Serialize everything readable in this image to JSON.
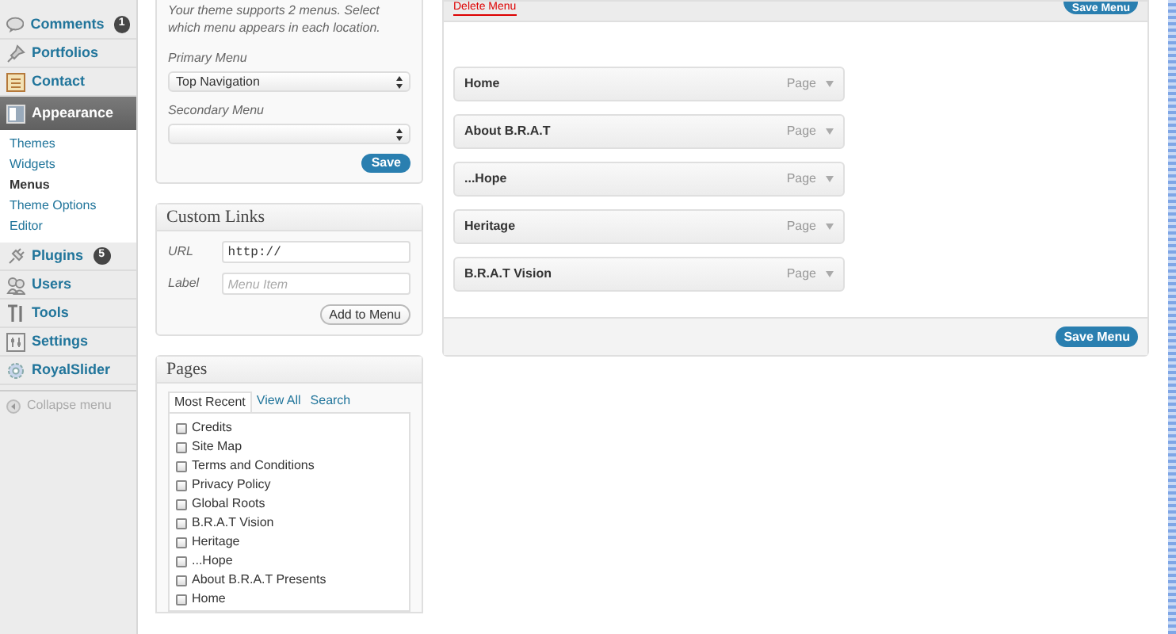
{
  "sidebar": {
    "items": [
      {
        "label": "Comments",
        "badge": "1",
        "selected": false
      },
      {
        "label": "Portfolios",
        "selected": false
      },
      {
        "label": "Contact",
        "selected": false
      },
      {
        "label": "Appearance",
        "selected": true,
        "children": [
          {
            "label": "Themes",
            "selected": false
          },
          {
            "label": "Widgets",
            "selected": false
          },
          {
            "label": "Menus",
            "selected": true
          },
          {
            "label": "Theme Options",
            "selected": false
          },
          {
            "label": "Editor",
            "selected": false
          }
        ]
      },
      {
        "label": "Plugins",
        "badge": "5",
        "selected": false
      },
      {
        "label": "Users",
        "selected": false
      },
      {
        "label": "Tools",
        "selected": false
      },
      {
        "label": "Settings",
        "selected": false
      },
      {
        "label": "RoyalSlider",
        "selected": false
      }
    ],
    "collapse": "Collapse menu"
  },
  "locations": {
    "note": "Your theme supports 2 menus. Select which menu appears in each location.",
    "fields": [
      {
        "label": "Primary Menu",
        "value": "Top Navigation"
      },
      {
        "label": "Secondary Menu"
      }
    ],
    "button": "Save"
  },
  "custom_links": {
    "title": "Custom Links",
    "url_label": "URL",
    "url_value": "http://",
    "label_label": "Label",
    "label_placeholder": "Menu Item",
    "button": "Add to Menu"
  },
  "pages": {
    "title": "Pages",
    "tabs": [
      {
        "label": "Most Recent",
        "selected": true
      },
      {
        "label": "View All",
        "selected": false
      },
      {
        "label": "Search",
        "selected": false
      }
    ],
    "items": [
      {
        "label": "Credits",
        "checked": false
      },
      {
        "label": "Site Map",
        "checked": false
      },
      {
        "label": "Terms and Conditions",
        "checked": false
      },
      {
        "label": "Privacy Policy",
        "checked": false
      },
      {
        "label": "Global Roots",
        "checked": false
      },
      {
        "label": "B.R.A.T Vision",
        "checked": false
      },
      {
        "label": "Heritage",
        "checked": false
      },
      {
        "label": "...Hope",
        "checked": false
      },
      {
        "label": "About B.R.A.T Presents",
        "checked": false
      },
      {
        "label": "Home",
        "checked": false
      }
    ]
  },
  "menu_editor": {
    "delete_link": "Delete Menu",
    "save_top": "Save Menu",
    "save_bottom": "Save Menu",
    "items": [
      {
        "title": "Home",
        "type": "Page"
      },
      {
        "title": "About B.R.A.T",
        "type": "Page"
      },
      {
        "title": "...Hope",
        "type": "Page"
      },
      {
        "title": "Heritage",
        "type": "Page"
      },
      {
        "title": "B.R.A.T Vision",
        "type": "Page"
      }
    ]
  }
}
